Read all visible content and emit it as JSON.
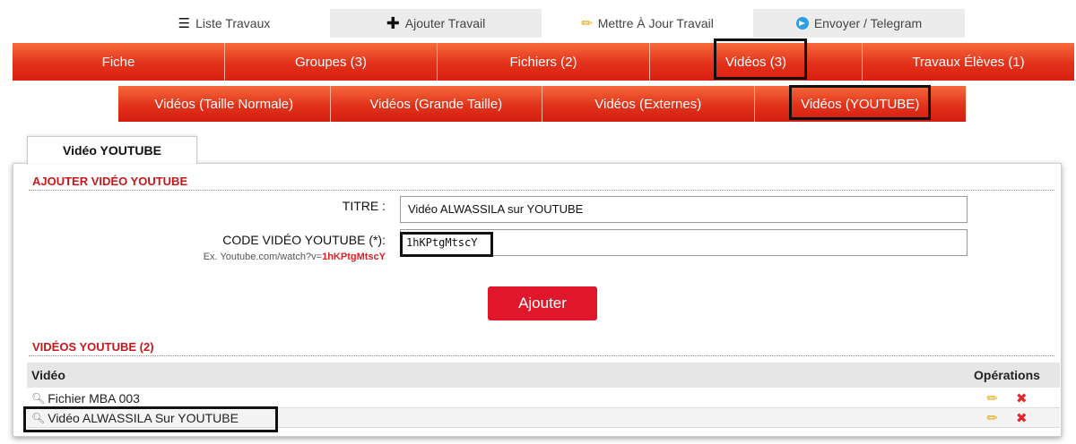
{
  "top_tabs": [
    {
      "label": "Liste Travaux",
      "icon": "list-icon"
    },
    {
      "label": "Ajouter Travail",
      "icon": "plus-icon"
    },
    {
      "label": "Mettre À Jour Travail",
      "icon": "pencil-icon"
    },
    {
      "label": "Envoyer / Telegram",
      "icon": "telegram-icon"
    }
  ],
  "main_nav": [
    {
      "label": "Fiche"
    },
    {
      "label": "Groupes (3)"
    },
    {
      "label": "Fichiers (2)"
    },
    {
      "label": "Vidéos (3)"
    },
    {
      "label": "Travaux Élèves (1)"
    }
  ],
  "sub_nav": [
    {
      "label": "Vidéos (Taille Normale)"
    },
    {
      "label": "Vidéos (Grande Taille)"
    },
    {
      "label": "Vidéos (Externes)"
    },
    {
      "label": "Vidéos (YOUTUBE)"
    }
  ],
  "panel": {
    "tab_label": "Vidéo YOUTUBE",
    "add_section_title": "AJOUTER VIDÉO YOUTUBE",
    "titre_label": "TITRE :",
    "titre_value": "Vidéo ALWASSILA sur YOUTUBE",
    "code_label": "CODE VIDÉO YOUTUBE (*):",
    "code_hint_prefix": "Ex. Youtube.com/watch?v=",
    "code_hint_code": "1hKPtgMtscY",
    "code_value": "1hKPtgMtscY",
    "submit_label": "Ajouter",
    "list_section_title": "VIDÉOS YOUTUBE (2)"
  },
  "table": {
    "headers": [
      "Vidéo",
      "Opérations"
    ],
    "rows": [
      {
        "title": "Fichier MBA 003"
      },
      {
        "title": "Vidéo ALWASSILA Sur YOUTUBE"
      }
    ]
  },
  "colors": {
    "nav_red": "#e2321b",
    "button_red": "#e0162b",
    "section_title_red": "#c8171b",
    "edit_icon": "#e8a417",
    "delete_icon": "#e2262b"
  }
}
